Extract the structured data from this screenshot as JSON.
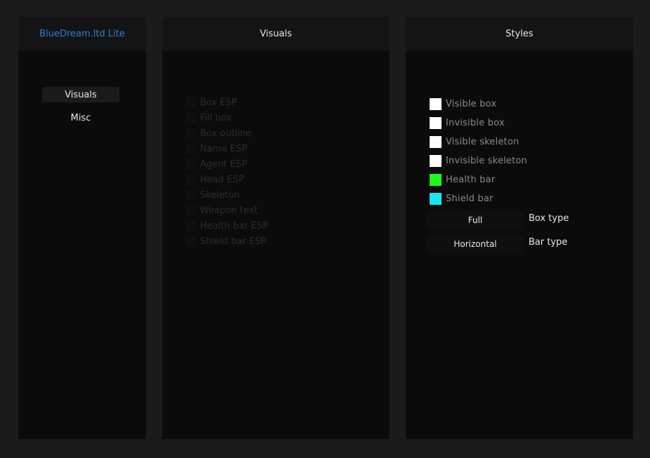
{
  "nav": {
    "title": "BlueDream.ltd Lite",
    "items": [
      {
        "label": "Visuals",
        "active": true
      },
      {
        "label": "Misc",
        "active": false
      }
    ]
  },
  "visuals": {
    "title": "Visuals",
    "options": [
      {
        "label": "Box ESP"
      },
      {
        "label": "Fill box"
      },
      {
        "label": "Box outline"
      },
      {
        "label": "Name ESP"
      },
      {
        "label": "Agent ESP"
      },
      {
        "label": "Head ESP"
      },
      {
        "label": "Skeleton"
      },
      {
        "label": "Weapon text"
      },
      {
        "label": "Health bar ESP"
      },
      {
        "label": "Shield bar ESP"
      }
    ]
  },
  "styles": {
    "title": "Styles",
    "colors": [
      {
        "label": "Visible box",
        "color": "#ffffff"
      },
      {
        "label": "Invisible box",
        "color": "#ffffff"
      },
      {
        "label": "Visible skeleton",
        "color": "#ffffff"
      },
      {
        "label": "Invisible skeleton",
        "color": "#ffffff"
      },
      {
        "label": "Health bar",
        "color": "#19ff19"
      },
      {
        "label": "Shield bar",
        "color": "#19e6f0"
      }
    ],
    "box_type": {
      "value": "Full",
      "label": "Box type"
    },
    "bar_type": {
      "value": "Horizontal",
      "label": "Bar type"
    }
  }
}
